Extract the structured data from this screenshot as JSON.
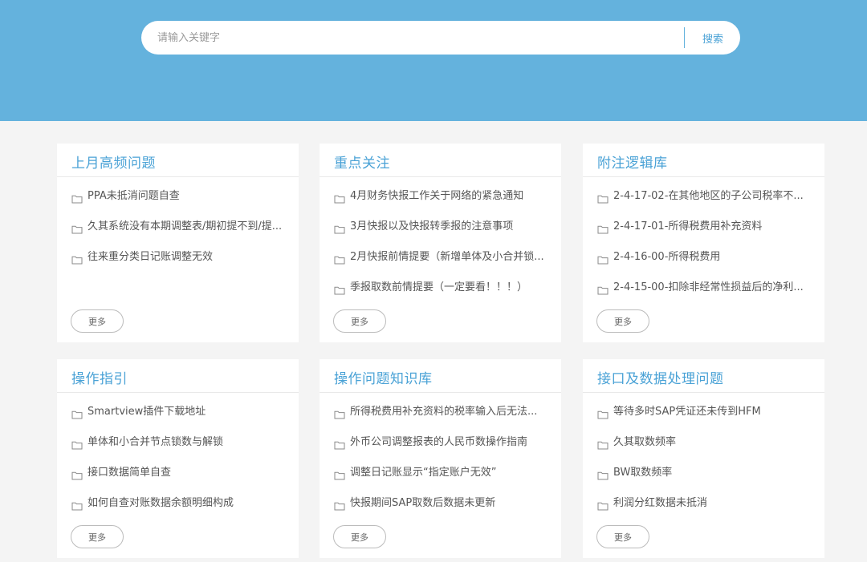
{
  "search": {
    "placeholder": "请输入关键字",
    "button_label": "搜索"
  },
  "cards": [
    {
      "title": "上月高频问题",
      "items": [
        "PPA未抵消问题自查",
        "久其系统没有本期调整表/期初提不到/提...",
        "往来重分类日记账调整无效"
      ],
      "more_label": "更多"
    },
    {
      "title": "重点关注",
      "items": [
        "4月财务快报工作关于网络的紧急通知",
        "3月快报以及快报转季报的注意事项",
        "2月快报前情提要（新增单体及小合并锁...",
        "季报取数前情提要（一定要看！！！）"
      ],
      "more_label": "更多"
    },
    {
      "title": "附注逻辑库",
      "items": [
        "2-4-17-02-在其他地区的子公司税率不...",
        "2-4-17-01-所得税费用补充资料",
        "2-4-16-00-所得税费用",
        "2-4-15-00-扣除非经常性损益后的净利..."
      ],
      "more_label": "更多"
    },
    {
      "title": "操作指引",
      "items": [
        "Smartview插件下载地址",
        "单体和小合并节点锁数与解锁",
        "接口数据简单自查",
        "如何自查对账数据余额明细构成"
      ],
      "more_label": "更多"
    },
    {
      "title": "操作问题知识库",
      "items": [
        "所得税费用补充资料的税率输入后无法...",
        "外币公司调整报表的人民币数操作指南",
        "调整日记账显示“指定账户无效”",
        "快报期间SAP取数后数据未更新"
      ],
      "more_label": "更多"
    },
    {
      "title": "接口及数据处理问题",
      "items": [
        "等待多时SAP凭证还未传到HFM",
        "久其取数频率",
        "BW取数频率",
        "利润分红数据未抵消"
      ],
      "more_label": "更多"
    }
  ],
  "colors": {
    "hero_background": "#64b2dd",
    "accent": "#4aa2d6",
    "page_background": "#f4f4f4"
  },
  "icons": {
    "item_icon": "folder-icon"
  }
}
